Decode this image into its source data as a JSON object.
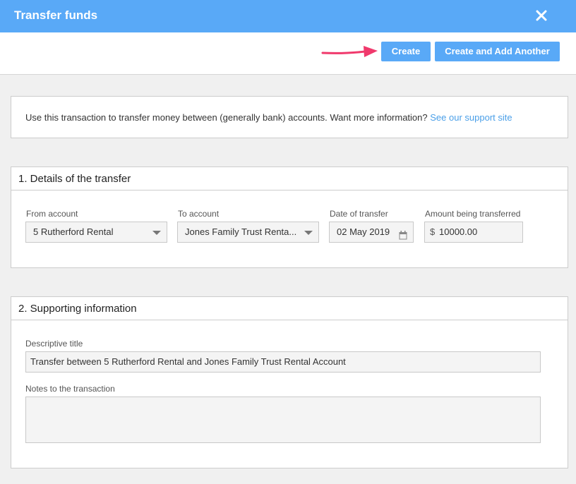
{
  "dialog": {
    "title": "Transfer funds",
    "close_icon": "close-icon"
  },
  "toolbar": {
    "create_label": "Create",
    "create_add_label": "Create and Add Another"
  },
  "info": {
    "text": "Use this transaction to transfer money between (generally bank) accounts. Want more information? ",
    "link": "See our support site"
  },
  "details": {
    "heading": "1. Details of the transfer",
    "from_label": "From account",
    "from_value": "5 Rutherford Rental",
    "to_label": "To account",
    "to_value": "Jones Family Trust Renta...",
    "date_label": "Date of transfer",
    "date_value": "02 May 2019",
    "amount_label": "Amount being transferred",
    "currency": "$",
    "amount_value": "10000.00"
  },
  "supporting": {
    "heading": "2. Supporting information",
    "title_label": "Descriptive title",
    "title_value": "Transfer between 5 Rutherford Rental and Jones Family Trust Rental Account",
    "notes_label": "Notes to the transaction",
    "notes_value": ""
  },
  "colors": {
    "accent": "#59a9f7",
    "link": "#4a9fe8",
    "arrow": "#f0396c"
  }
}
